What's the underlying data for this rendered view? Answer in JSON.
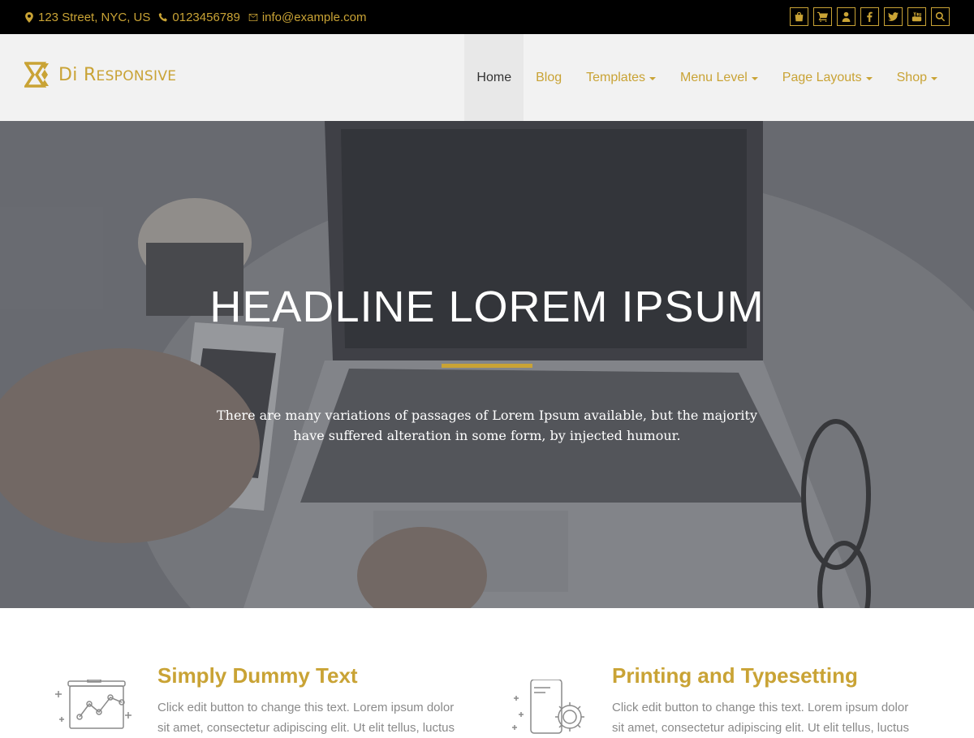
{
  "topbar": {
    "address": "123 Street, NYC, US",
    "phone": "0123456789",
    "email": "info@example.com",
    "social_icons": [
      "shopping-bag-icon",
      "cart-icon",
      "user-icon",
      "facebook-icon",
      "twitter-icon",
      "youtube-icon",
      "search-icon"
    ]
  },
  "header": {
    "logo_text_initial": "Di R",
    "logo_text_rest": "ESPONSIVE",
    "nav": [
      {
        "label": "Home",
        "active": true,
        "dropdown": false
      },
      {
        "label": "Blog",
        "active": false,
        "dropdown": false
      },
      {
        "label": "Templates",
        "active": false,
        "dropdown": true
      },
      {
        "label": "Menu Level",
        "active": false,
        "dropdown": true
      },
      {
        "label": "Page Layouts",
        "active": false,
        "dropdown": true
      },
      {
        "label": "Shop",
        "active": false,
        "dropdown": true
      }
    ]
  },
  "hero": {
    "headline": "HEADLINE LOREM IPSUM",
    "text": "There are many variations of passages of Lorem Ipsum available, but the majority have suffered alteration in some form, by injected humour."
  },
  "features": [
    {
      "title": "Simply Dummy Text",
      "desc": "Click edit button to change this text. Lorem ipsum dolor sit amet, consectetur adipiscing elit. Ut elit tellus, luctus",
      "icon": "chart-board-icon"
    },
    {
      "title": "Printing and Typesetting",
      "desc": "Click edit button to change this text. Lorem ipsum dolor sit amet, consectetur adipiscing elit. Ut elit tellus, luctus",
      "icon": "mobile-gear-icon"
    }
  ],
  "colors": {
    "accent": "#c9a335",
    "topbar_bg": "#000000",
    "header_bg": "#f2f2f2"
  }
}
